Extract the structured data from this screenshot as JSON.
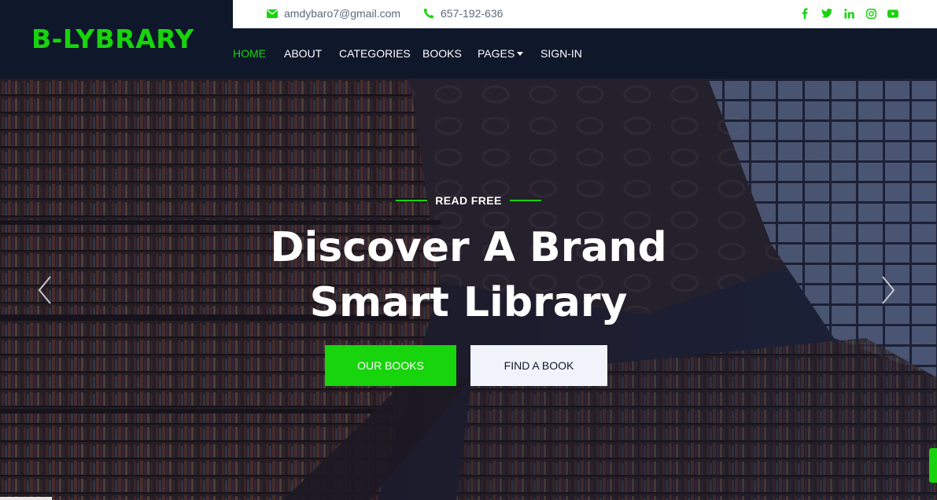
{
  "brand": {
    "name": "B-LYBRARY",
    "color": "#17d40c"
  },
  "topbar": {
    "email": "amdybaro7@gmail.com",
    "phone": "657-192-636",
    "email_icon": "envelope-icon",
    "phone_icon": "phone-icon",
    "socials": [
      "facebook-icon",
      "twitter-icon",
      "linkedin-icon",
      "instagram-icon",
      "youtube-icon"
    ]
  },
  "nav": {
    "items": [
      {
        "label": "HOME",
        "active": true
      },
      {
        "label": "ABOUT"
      },
      {
        "label": "CATEGORIES"
      },
      {
        "label": "BOOKS"
      },
      {
        "label": "PAGES",
        "dropdown": true
      },
      {
        "label": "SIGN-IN"
      }
    ]
  },
  "hero": {
    "eyebrow": "READ FREE",
    "title_line1": "Discover A Brand",
    "title_line2": "Smart Library",
    "primary_button": "OUR BOOKS",
    "secondary_button": "FIND A BOOK",
    "prev_icon": "chevron-left-icon",
    "next_icon": "chevron-right-icon"
  },
  "colors": {
    "accent": "#17d40c",
    "dark": "#0f172b",
    "light_button": "#f0f4fa"
  }
}
